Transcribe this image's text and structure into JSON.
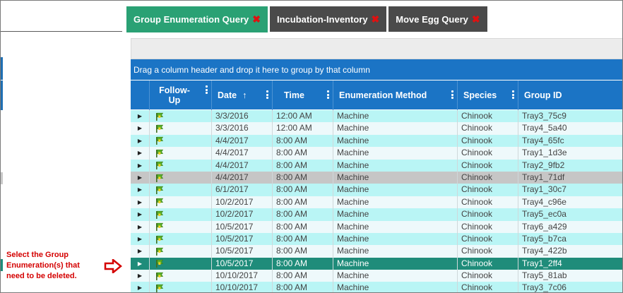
{
  "tabs": [
    {
      "label": "Group Enumeration Query",
      "active": true
    },
    {
      "label": "Incubation-Inventory",
      "active": false
    },
    {
      "label": "Move Egg Query",
      "active": false
    }
  ],
  "grid": {
    "group_by_hint": "Drag a column header and drop it here to group by that column",
    "columns": {
      "follow_up_line1": "Follow-",
      "follow_up_line2": "Up",
      "date": "Date",
      "date_sort": "↑",
      "time": "Time",
      "method": "Enumeration Method",
      "species": "Species",
      "group_id": "Group ID"
    },
    "rows": [
      {
        "date": "3/3/2016",
        "time": "12:00 AM",
        "method": "Machine",
        "species": "Chinook",
        "group_id": "Tray3_75c9"
      },
      {
        "date": "3/3/2016",
        "time": "12:00 AM",
        "method": "Machine",
        "species": "Chinook",
        "group_id": "Tray4_5a40"
      },
      {
        "date": "4/4/2017",
        "time": "8:00 AM",
        "method": "Machine",
        "species": "Chinook",
        "group_id": "Tray4_65fc"
      },
      {
        "date": "4/4/2017",
        "time": "8:00 AM",
        "method": "Machine",
        "species": "Chinook",
        "group_id": "Tray1_1d3e"
      },
      {
        "date": "4/4/2017",
        "time": "8:00 AM",
        "method": "Machine",
        "species": "Chinook",
        "group_id": "Tray2_9fb2"
      },
      {
        "date": "4/4/2017",
        "time": "8:00 AM",
        "method": "Machine",
        "species": "Chinook",
        "group_id": "Tray1_71df"
      },
      {
        "date": "6/1/2017",
        "time": "8:00 AM",
        "method": "Machine",
        "species": "Chinook",
        "group_id": "Tray1_30c7"
      },
      {
        "date": "10/2/2017",
        "time": "8:00 AM",
        "method": "Machine",
        "species": "Chinook",
        "group_id": "Tray4_c96e"
      },
      {
        "date": "10/2/2017",
        "time": "8:00 AM",
        "method": "Machine",
        "species": "Chinook",
        "group_id": "Tray5_ec0a"
      },
      {
        "date": "10/5/2017",
        "time": "8:00 AM",
        "method": "Machine",
        "species": "Chinook",
        "group_id": "Tray6_a429"
      },
      {
        "date": "10/5/2017",
        "time": "8:00 AM",
        "method": "Machine",
        "species": "Chinook",
        "group_id": "Tray5_b7ca"
      },
      {
        "date": "10/5/2017",
        "time": "8:00 AM",
        "method": "Machine",
        "species": "Chinook",
        "group_id": "Tray4_422b"
      },
      {
        "date": "10/5/2017",
        "time": "8:00 AM",
        "method": "Machine",
        "species": "Chinook",
        "group_id": "Tray1_2ff4"
      },
      {
        "date": "10/10/2017",
        "time": "8:00 AM",
        "method": "Machine",
        "species": "Chinook",
        "group_id": "Tray5_81ab"
      },
      {
        "date": "10/10/2017",
        "time": "8:00 AM",
        "method": "Machine",
        "species": "Chinook",
        "group_id": "Tray3_7c06"
      }
    ],
    "hover_row_index": 5,
    "selected_row_index": 12
  },
  "annotation": {
    "line1": "Select the Group",
    "line2": "Enumeration(s) that",
    "line3": "need to be deleted."
  },
  "colors": {
    "tab_active": "#2aa174",
    "tab_inactive": "#4a4a4a",
    "header_blue": "#1b74c5",
    "row_cyan": "#b9f5f5",
    "row_selected": "#1f8c7a",
    "annotation_red": "#d40000"
  },
  "icons": {
    "row_flag": "green-flag-icon",
    "row_expand": "triangle-right-icon",
    "column_menu": "kebab-menu-icon",
    "tab_close": "red-x-icon",
    "annotation_arrow": "red-arrow-right-icon"
  }
}
